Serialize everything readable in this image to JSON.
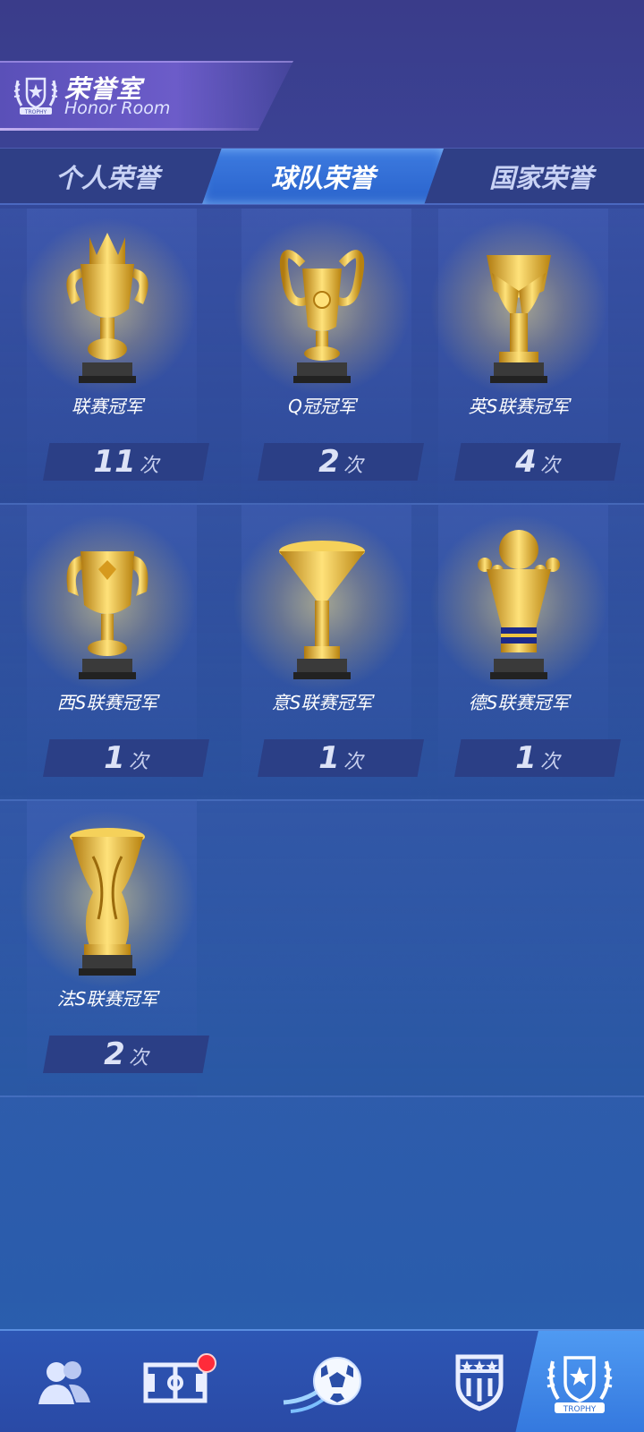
{
  "header": {
    "title_cn": "荣誉室",
    "title_en": "Honor Room",
    "emblem_text": "TROPHY"
  },
  "tabs": [
    {
      "label": "个人荣誉",
      "active": false
    },
    {
      "label": "球队荣誉",
      "active": true
    },
    {
      "label": "国家荣誉",
      "active": false
    }
  ],
  "awards": [
    {
      "name": "联赛冠军",
      "count": "11",
      "unit": "次",
      "icon": "premier-trophy-icon"
    },
    {
      "name": "Q冠冠军",
      "count": "2",
      "unit": "次",
      "icon": "champions-cup-icon"
    },
    {
      "name": "英S联赛冠军",
      "count": "4",
      "unit": "次",
      "icon": "winged-trophy-icon"
    },
    {
      "name": "西S联赛冠军",
      "count": "1",
      "unit": "次",
      "icon": "goblet-trophy-icon"
    },
    {
      "name": "意S联赛冠军",
      "count": "1",
      "unit": "次",
      "icon": "cone-trophy-icon"
    },
    {
      "name": "德S联赛冠军",
      "count": "1",
      "unit": "次",
      "icon": "ball-trophy-icon"
    },
    {
      "name": "法S联赛冠军",
      "count": "2",
      "unit": "次",
      "icon": "vase-trophy-icon"
    }
  ],
  "bottom_nav": [
    {
      "icon": "team-members-icon",
      "active": false
    },
    {
      "icon": "tactics-board-icon",
      "active": false,
      "badge": true
    },
    {
      "icon": "soccer-ball-icon",
      "active": false
    },
    {
      "icon": "club-crest-icon",
      "active": false
    },
    {
      "icon": "trophy-emblem-icon",
      "active": true,
      "text": "TROPHY"
    }
  ],
  "colors": {
    "gold": "#f2c230",
    "accent_blue": "#3d7be0",
    "badge_red": "#ff2b3a"
  }
}
